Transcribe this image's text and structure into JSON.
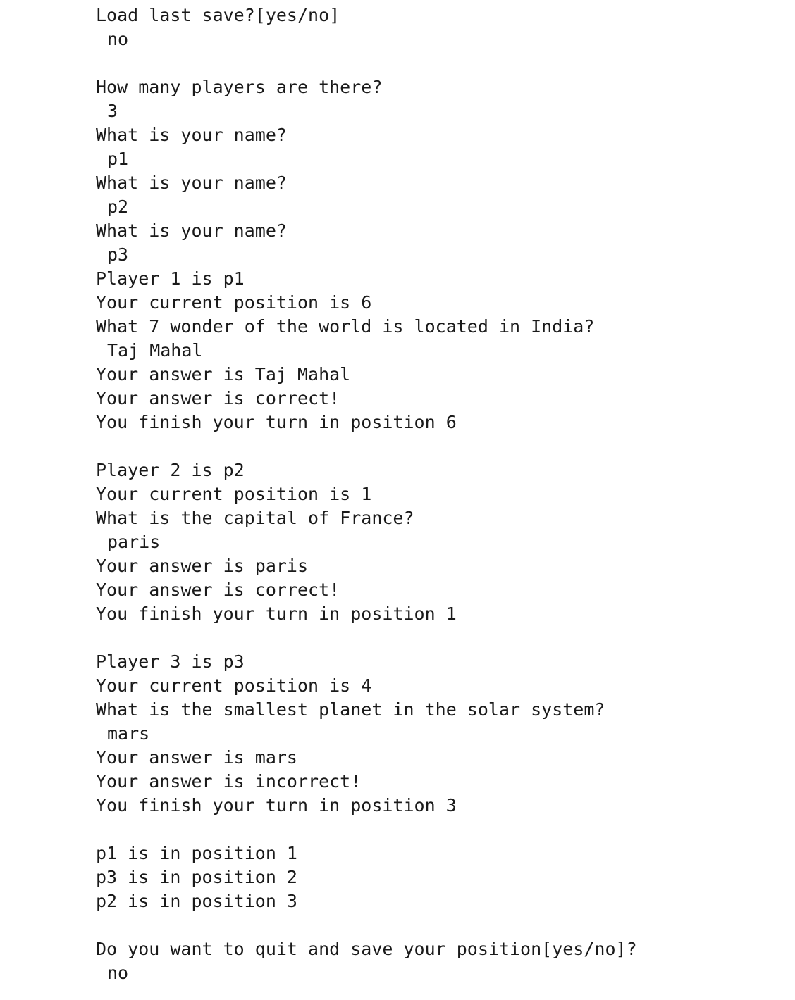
{
  "console": {
    "lines": [
      {
        "text": "Load last save?[yes/no]",
        "kind": "prompt"
      },
      {
        "text": "no",
        "kind": "input"
      },
      {
        "text": "",
        "kind": "blank"
      },
      {
        "text": "How many players are there?",
        "kind": "prompt"
      },
      {
        "text": "3",
        "kind": "input"
      },
      {
        "text": "What is your name?",
        "kind": "prompt"
      },
      {
        "text": "p1",
        "kind": "input"
      },
      {
        "text": "What is your name?",
        "kind": "prompt"
      },
      {
        "text": "p2",
        "kind": "input"
      },
      {
        "text": "What is your name?",
        "kind": "prompt"
      },
      {
        "text": "p3",
        "kind": "input"
      },
      {
        "text": "Player 1 is p1",
        "kind": "output"
      },
      {
        "text": "Your current position is 6",
        "kind": "output"
      },
      {
        "text": "What 7 wonder of the world is located in India?",
        "kind": "prompt"
      },
      {
        "text": "Taj Mahal",
        "kind": "input"
      },
      {
        "text": "Your answer is Taj Mahal",
        "kind": "output"
      },
      {
        "text": "Your answer is correct!",
        "kind": "output"
      },
      {
        "text": "You finish your turn in position 6",
        "kind": "output"
      },
      {
        "text": "",
        "kind": "blank"
      },
      {
        "text": "Player 2 is p2",
        "kind": "output"
      },
      {
        "text": "Your current position is 1",
        "kind": "output"
      },
      {
        "text": "What is the capital of France?",
        "kind": "prompt"
      },
      {
        "text": "paris",
        "kind": "input"
      },
      {
        "text": "Your answer is paris",
        "kind": "output"
      },
      {
        "text": "Your answer is correct!",
        "kind": "output"
      },
      {
        "text": "You finish your turn in position 1",
        "kind": "output"
      },
      {
        "text": "",
        "kind": "blank"
      },
      {
        "text": "Player 3 is p3",
        "kind": "output"
      },
      {
        "text": "Your current position is 4",
        "kind": "output"
      },
      {
        "text": "What is the smallest planet in the solar system?",
        "kind": "prompt"
      },
      {
        "text": "mars",
        "kind": "input"
      },
      {
        "text": "Your answer is mars",
        "kind": "output"
      },
      {
        "text": "Your answer is incorrect!",
        "kind": "output"
      },
      {
        "text": "You finish your turn in position 3",
        "kind": "output"
      },
      {
        "text": "",
        "kind": "blank"
      },
      {
        "text": "p1 is in position 1",
        "kind": "output"
      },
      {
        "text": "p3 is in position 2",
        "kind": "output"
      },
      {
        "text": "p2 is in position 3",
        "kind": "output"
      },
      {
        "text": "",
        "kind": "blank"
      },
      {
        "text": "Do you want to quit and save your position[yes/no]?",
        "kind": "prompt"
      },
      {
        "text": "no",
        "kind": "input"
      }
    ]
  }
}
